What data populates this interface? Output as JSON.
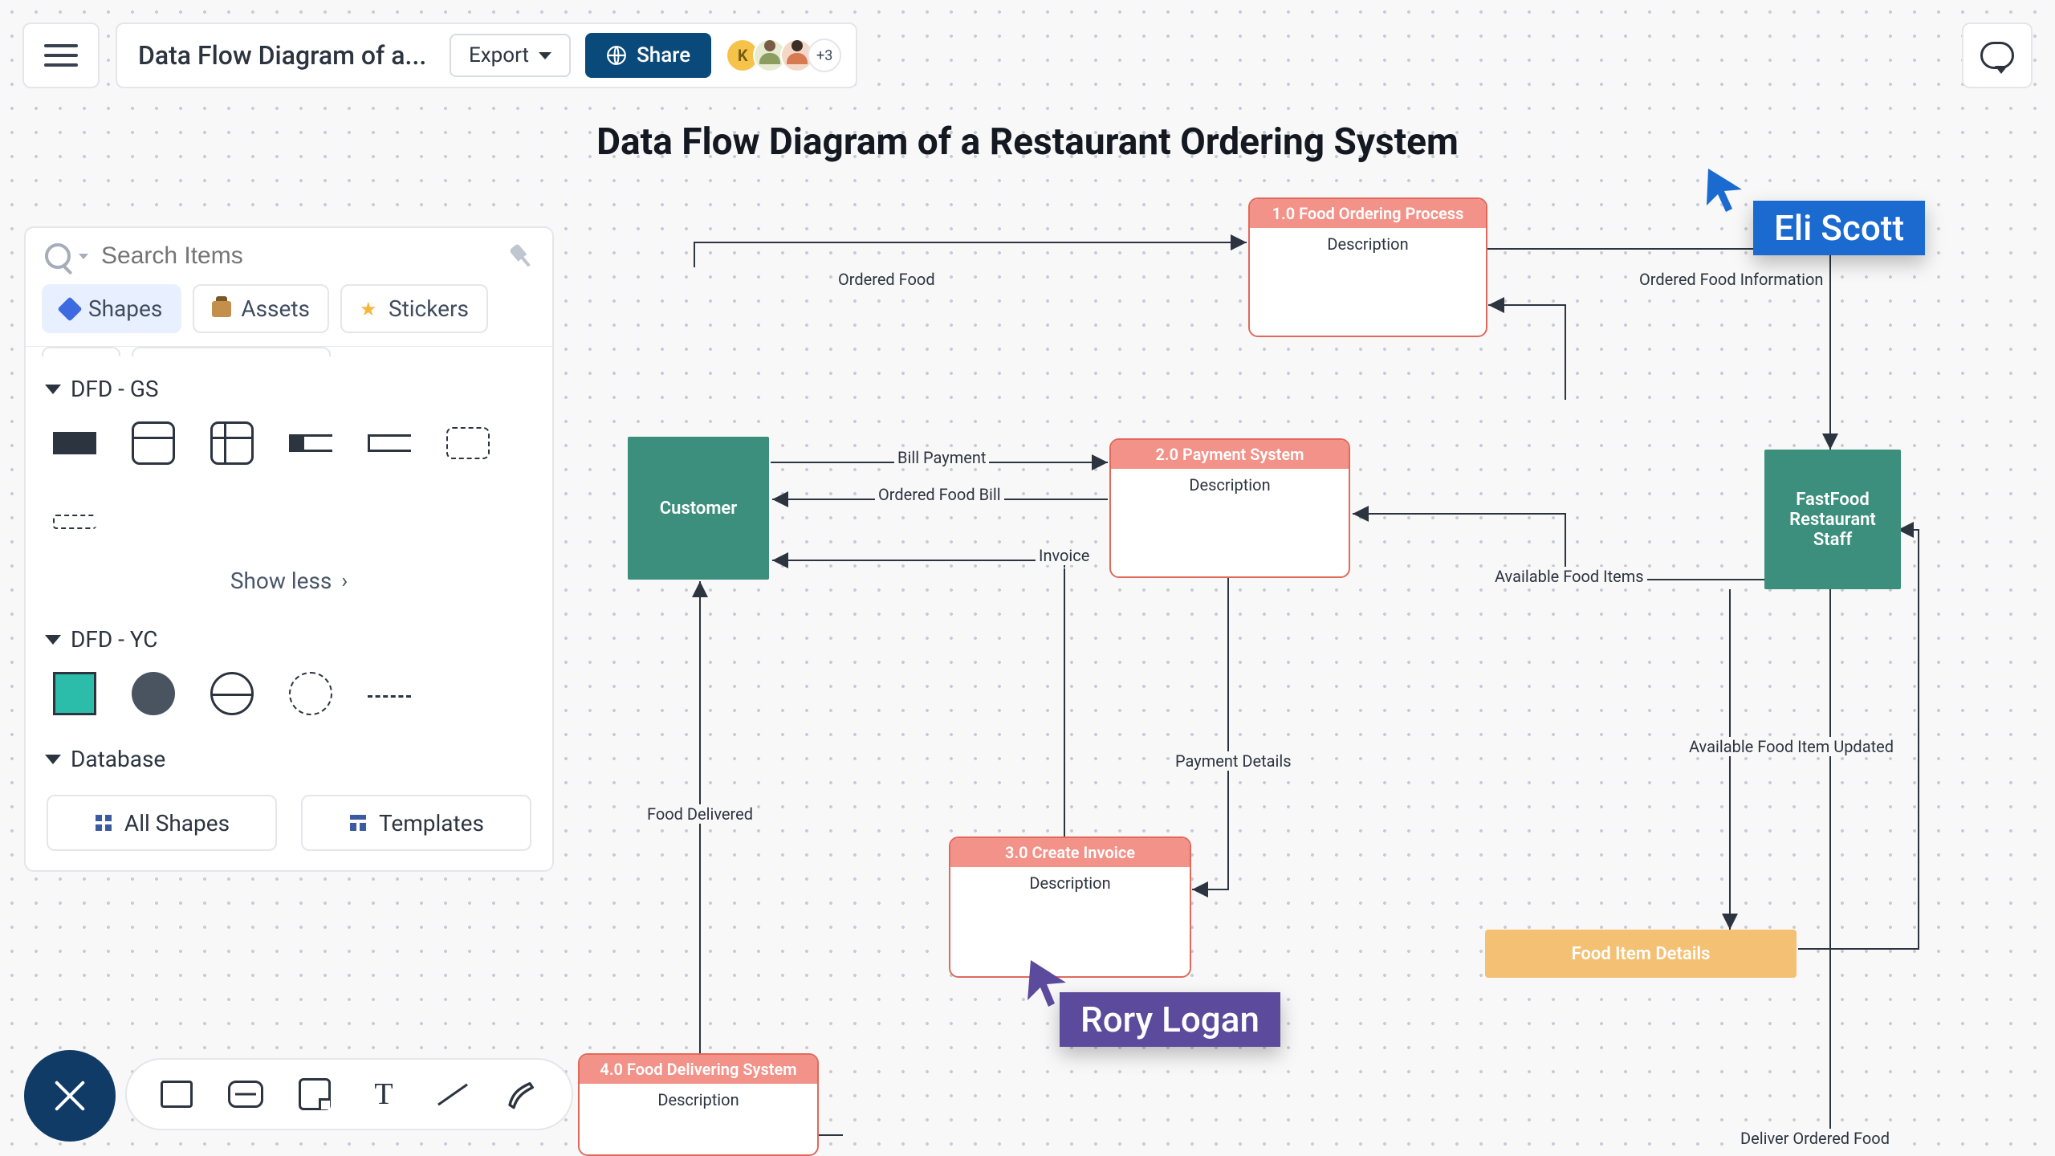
{
  "doc": {
    "title": "Data Flow Diagram of a..."
  },
  "topbar": {
    "export_label": "Export",
    "share_label": "Share",
    "avatar_letter": "K",
    "avatar_extra": "+3"
  },
  "search": {
    "placeholder": "Search Items"
  },
  "tabs": {
    "shapes": "Shapes",
    "assets": "Assets",
    "stickers": "Stickers"
  },
  "cats": {
    "gs": "DFD - GS",
    "yc": "DFD - YC",
    "db": "Database",
    "show_less": "Show less"
  },
  "footer": {
    "all_shapes": "All Shapes",
    "templates": "Templates"
  },
  "diagram": {
    "title": "Data Flow Diagram of a Restaurant Ordering System",
    "entities": {
      "customer": "Customer",
      "staff": "FastFood Restaurant Staff"
    },
    "processes": {
      "p1": {
        "head": "1.0  Food Ordering Process",
        "desc": "Description"
      },
      "p2": {
        "head": "2.0 Payment System",
        "desc": "Description"
      },
      "p3": {
        "head": "3.0 Create Invoice",
        "desc": "Description"
      },
      "p4": {
        "head": "4.0 Food Delivering System",
        "desc": "Description"
      }
    },
    "datastores": {
      "d1": "Food Item Details"
    },
    "labels": {
      "ordered_food": "Ordered Food",
      "ordered_food_info": "Ordered Food Information",
      "bill_payment": "Bill Payment",
      "ordered_food_bill": "Ordered Food Bill",
      "invoice": "Invoice",
      "available_food_items": "Available Food Items",
      "payment_details": "Payment Details",
      "food_delivered": "Food Delivered",
      "available_updated": "Available Food Item Updated",
      "deliver_ordered": "Deliver Ordered Food"
    }
  },
  "collab": {
    "eli": "Eli Scott",
    "rory": "Rory Logan"
  }
}
